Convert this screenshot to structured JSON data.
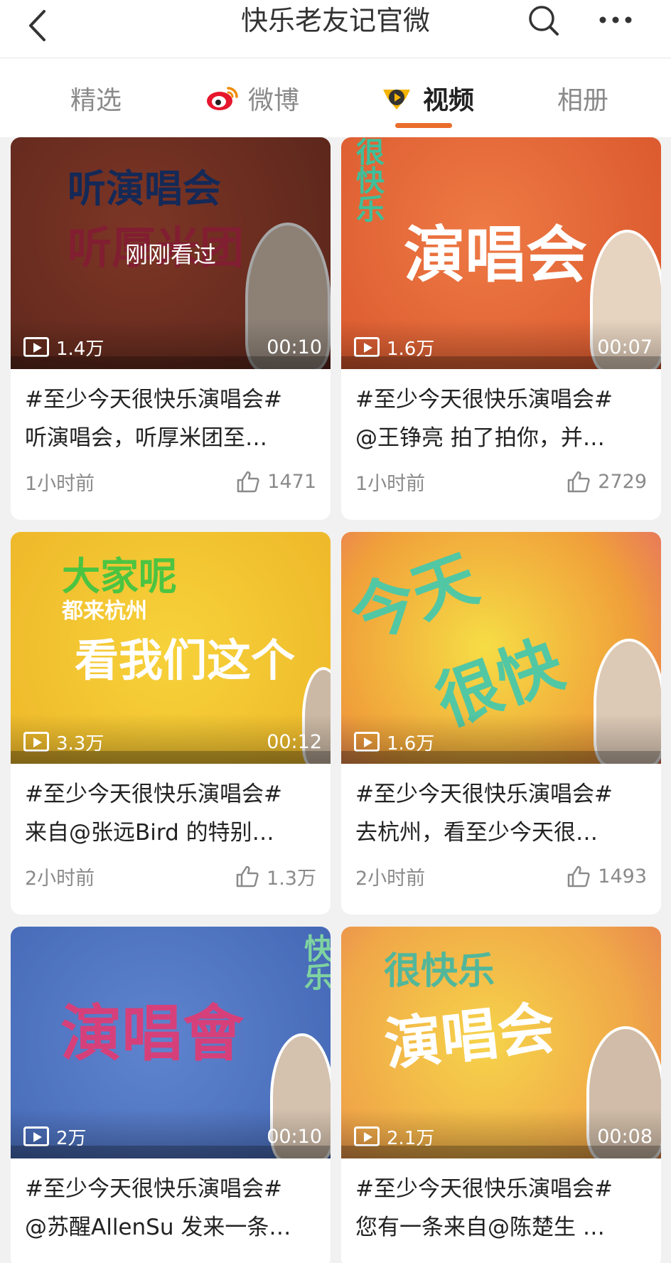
{
  "header": {
    "title": "快乐老友记官微"
  },
  "tabs": [
    {
      "label": "精选",
      "icon": "none"
    },
    {
      "label": "微博",
      "icon": "weibo-logo-icon"
    },
    {
      "label": "视频",
      "icon": "video-logo-icon",
      "active": true
    },
    {
      "label": "相册",
      "icon": "none"
    }
  ],
  "colors": {
    "accent": "#ea6d2c",
    "card_bg": "#ffffff",
    "page_bg": "#f1f1f1"
  },
  "cards": [
    {
      "thumb_text": [
        "听演唱会",
        "听厚米团"
      ],
      "overlay": "刚刚看过",
      "views": "1.4万",
      "duration": "00:10",
      "title_line1": "#至少今天很快乐演唱会#",
      "title_line2": "听演唱会，听厚米团至…",
      "time": "1小时前",
      "likes": "1471"
    },
    {
      "thumb_text": [
        "演唱会"
      ],
      "views": "1.6万",
      "duration": "00:07",
      "title_line1": "#至少今天很快乐演唱会#",
      "title_line2": "@王铮亮 拍了拍你，并…",
      "time": "1小时前",
      "likes": "2729"
    },
    {
      "thumb_text": [
        "大家呢",
        "都来杭州",
        "看我们这个"
      ],
      "views": "3.3万",
      "duration": "00:12",
      "title_line1": "#至少今天很快乐演唱会#",
      "title_line2": "来自@张远Bird 的特别…",
      "time": "2小时前",
      "likes": "1.3万"
    },
    {
      "thumb_text": [
        "今天",
        "很快"
      ],
      "views": "1.6万",
      "duration": "",
      "title_line1": "#至少今天很快乐演唱会#",
      "title_line2": "去杭州，看至少今天很…",
      "time": "2小时前",
      "likes": "1493"
    },
    {
      "thumb_text": [
        "演唱會",
        "快乐"
      ],
      "views": "2万",
      "duration": "00:10",
      "title_line1": "#至少今天很快乐演唱会#",
      "title_line2": "@苏醒AllenSu 发来一条…",
      "time": "",
      "likes": ""
    },
    {
      "thumb_text": [
        "很快乐",
        "演唱会"
      ],
      "views": "2.1万",
      "duration": "00:08",
      "title_line1": "#至少今天很快乐演唱会#",
      "title_line2": "您有一条来自@陈楚生 …",
      "time": "",
      "likes": ""
    }
  ]
}
